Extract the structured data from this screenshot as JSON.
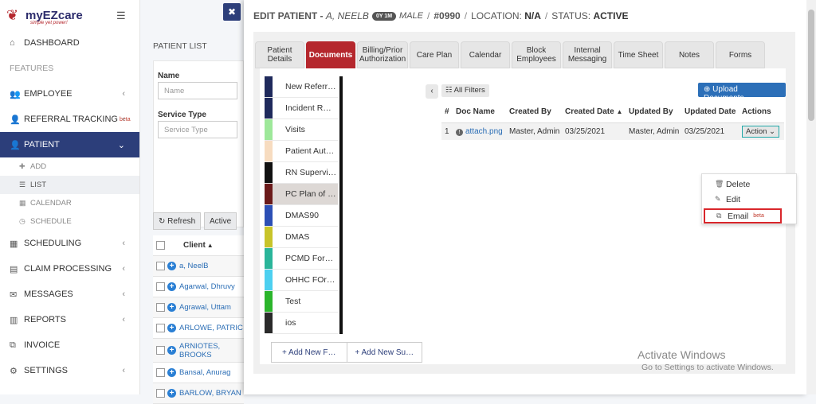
{
  "app": {
    "logo_text": "myEZcare",
    "logo_tagline": "simple yet power!"
  },
  "sidebar": {
    "items": [
      {
        "label": "DASHBOARD"
      },
      {
        "section": "FEATURES"
      },
      {
        "label": "EMPLOYEE"
      },
      {
        "label": "REFERRAL TRACKING",
        "badge": "beta"
      },
      {
        "label": "PATIENT",
        "active": true
      },
      {
        "sub": "ADD"
      },
      {
        "sub": "LIST",
        "active": true
      },
      {
        "sub": "CALENDAR"
      },
      {
        "sub": "SCHEDULE"
      },
      {
        "label": "SCHEDULING"
      },
      {
        "label": "CLAIM PROCESSING"
      },
      {
        "label": "MESSAGES"
      },
      {
        "label": "REPORTS"
      },
      {
        "label": "INVOICE"
      },
      {
        "label": "SETTINGS"
      }
    ]
  },
  "patient_list": {
    "title": "PATIENT LIST",
    "name_label": "Name",
    "name_placeholder": "Name",
    "service_label": "Service Type",
    "service_placeholder": "Service Type",
    "refresh_label": "Refresh",
    "active_label": "Active",
    "client_header": "Client",
    "clients": [
      "a, NeelB",
      "Agarwal, Dhruvy",
      "Agrawal, Uttam",
      "ARLOWE, PATRIC",
      "ARNIOTES, BROOKS",
      "Bansal, Anurag",
      "BARLOW, BRYAN"
    ]
  },
  "modal": {
    "prefix": "EDIT PATIENT -",
    "name": "A, NEELB",
    "age": "0Y 1M",
    "gender": "MALE",
    "id": "#0990",
    "location_label": "LOCATION:",
    "location": "N/A",
    "status_label": "STATUS:",
    "status": "ACTIVE",
    "tabs": [
      {
        "label": "Patient Details"
      },
      {
        "label": "Documents",
        "active": true
      },
      {
        "label": "Billing/Prior Authorization"
      },
      {
        "label": "Care Plan"
      },
      {
        "label": "Calendar"
      },
      {
        "label": "Block Employees"
      },
      {
        "label": "Internal Messaging"
      },
      {
        "label": "Time Sheet"
      },
      {
        "label": "Notes"
      },
      {
        "label": "Forms"
      }
    ]
  },
  "documents": {
    "folders": [
      {
        "label": "New Referr…",
        "color": "#1f2a5c"
      },
      {
        "label": "Incident R…",
        "color": "#1f2a5c"
      },
      {
        "label": "Visits",
        "color": "#9ee89a"
      },
      {
        "label": "Patient Aut…",
        "color": "#f7dcc0"
      },
      {
        "label": "RN Supervi…",
        "color": "#111111"
      },
      {
        "label": "PC Plan of …",
        "color": "#6b1a1a",
        "selected": true
      },
      {
        "label": "DMAS90",
        "color": "#2c4fb5"
      },
      {
        "label": "DMAS",
        "color": "#c8c42a"
      },
      {
        "label": "PCMD For…",
        "color": "#2ab59a"
      },
      {
        "label": "OHHC FOr…",
        "color": "#4dd0f0"
      },
      {
        "label": "Test",
        "color": "#2bb52b"
      },
      {
        "label": "ios",
        "color": "#2a2a2a"
      }
    ],
    "add_folder_label": "+ Add New F…",
    "add_sub_label": "+ Add New Su…",
    "all_filters_label": "All Filters",
    "upload_label": "Upload Documents",
    "columns": [
      "#",
      "Doc Name",
      "Created By",
      "Created Date",
      "Updated By",
      "Updated Date",
      "Actions"
    ],
    "rows": [
      {
        "num": "1",
        "doc": "attach.png",
        "created_by": "Master, Admin",
        "created_date": "03/25/2021",
        "updated_by": "Master, Admin",
        "updated_date": "03/25/2021",
        "action": "Action"
      }
    ],
    "menu": {
      "delete": "Delete",
      "edit": "Edit",
      "email": "Email",
      "email_badge": "beta"
    }
  },
  "watermark": {
    "title": "Activate Windows",
    "subtitle": "Go to Settings to activate Windows."
  },
  "colors": {
    "primary": "#2c3e7a",
    "accent": "#b5272d",
    "highlight": "#d9262b",
    "link": "#2a6db5"
  }
}
